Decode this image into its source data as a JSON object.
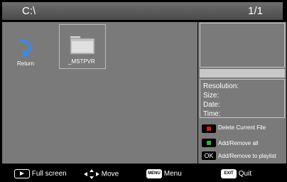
{
  "header": {
    "path": "C:\\",
    "page": "1/1"
  },
  "browser": {
    "items": [
      {
        "label": "Return",
        "icon": "return-arrow-icon"
      },
      {
        "label": "_MSTPVR",
        "icon": "folder-icon"
      }
    ]
  },
  "info": {
    "resolution": "Resolution:",
    "size": "Size:",
    "date": "Date:",
    "time": "Time:"
  },
  "legend": {
    "delete": {
      "color": "#d01c1c",
      "label": "Delete Current File"
    },
    "add_all": {
      "color": "#2fb02f",
      "label": "Add/Remove all"
    },
    "add_playlist": {
      "key": "OK",
      "label": "Add/Remove to playlist"
    }
  },
  "footer": {
    "fullscreen": "Full screen",
    "move": "Move",
    "menu_key": "MENU",
    "menu": "Menu",
    "exit_key": "EXIT",
    "quit": "Quit"
  }
}
